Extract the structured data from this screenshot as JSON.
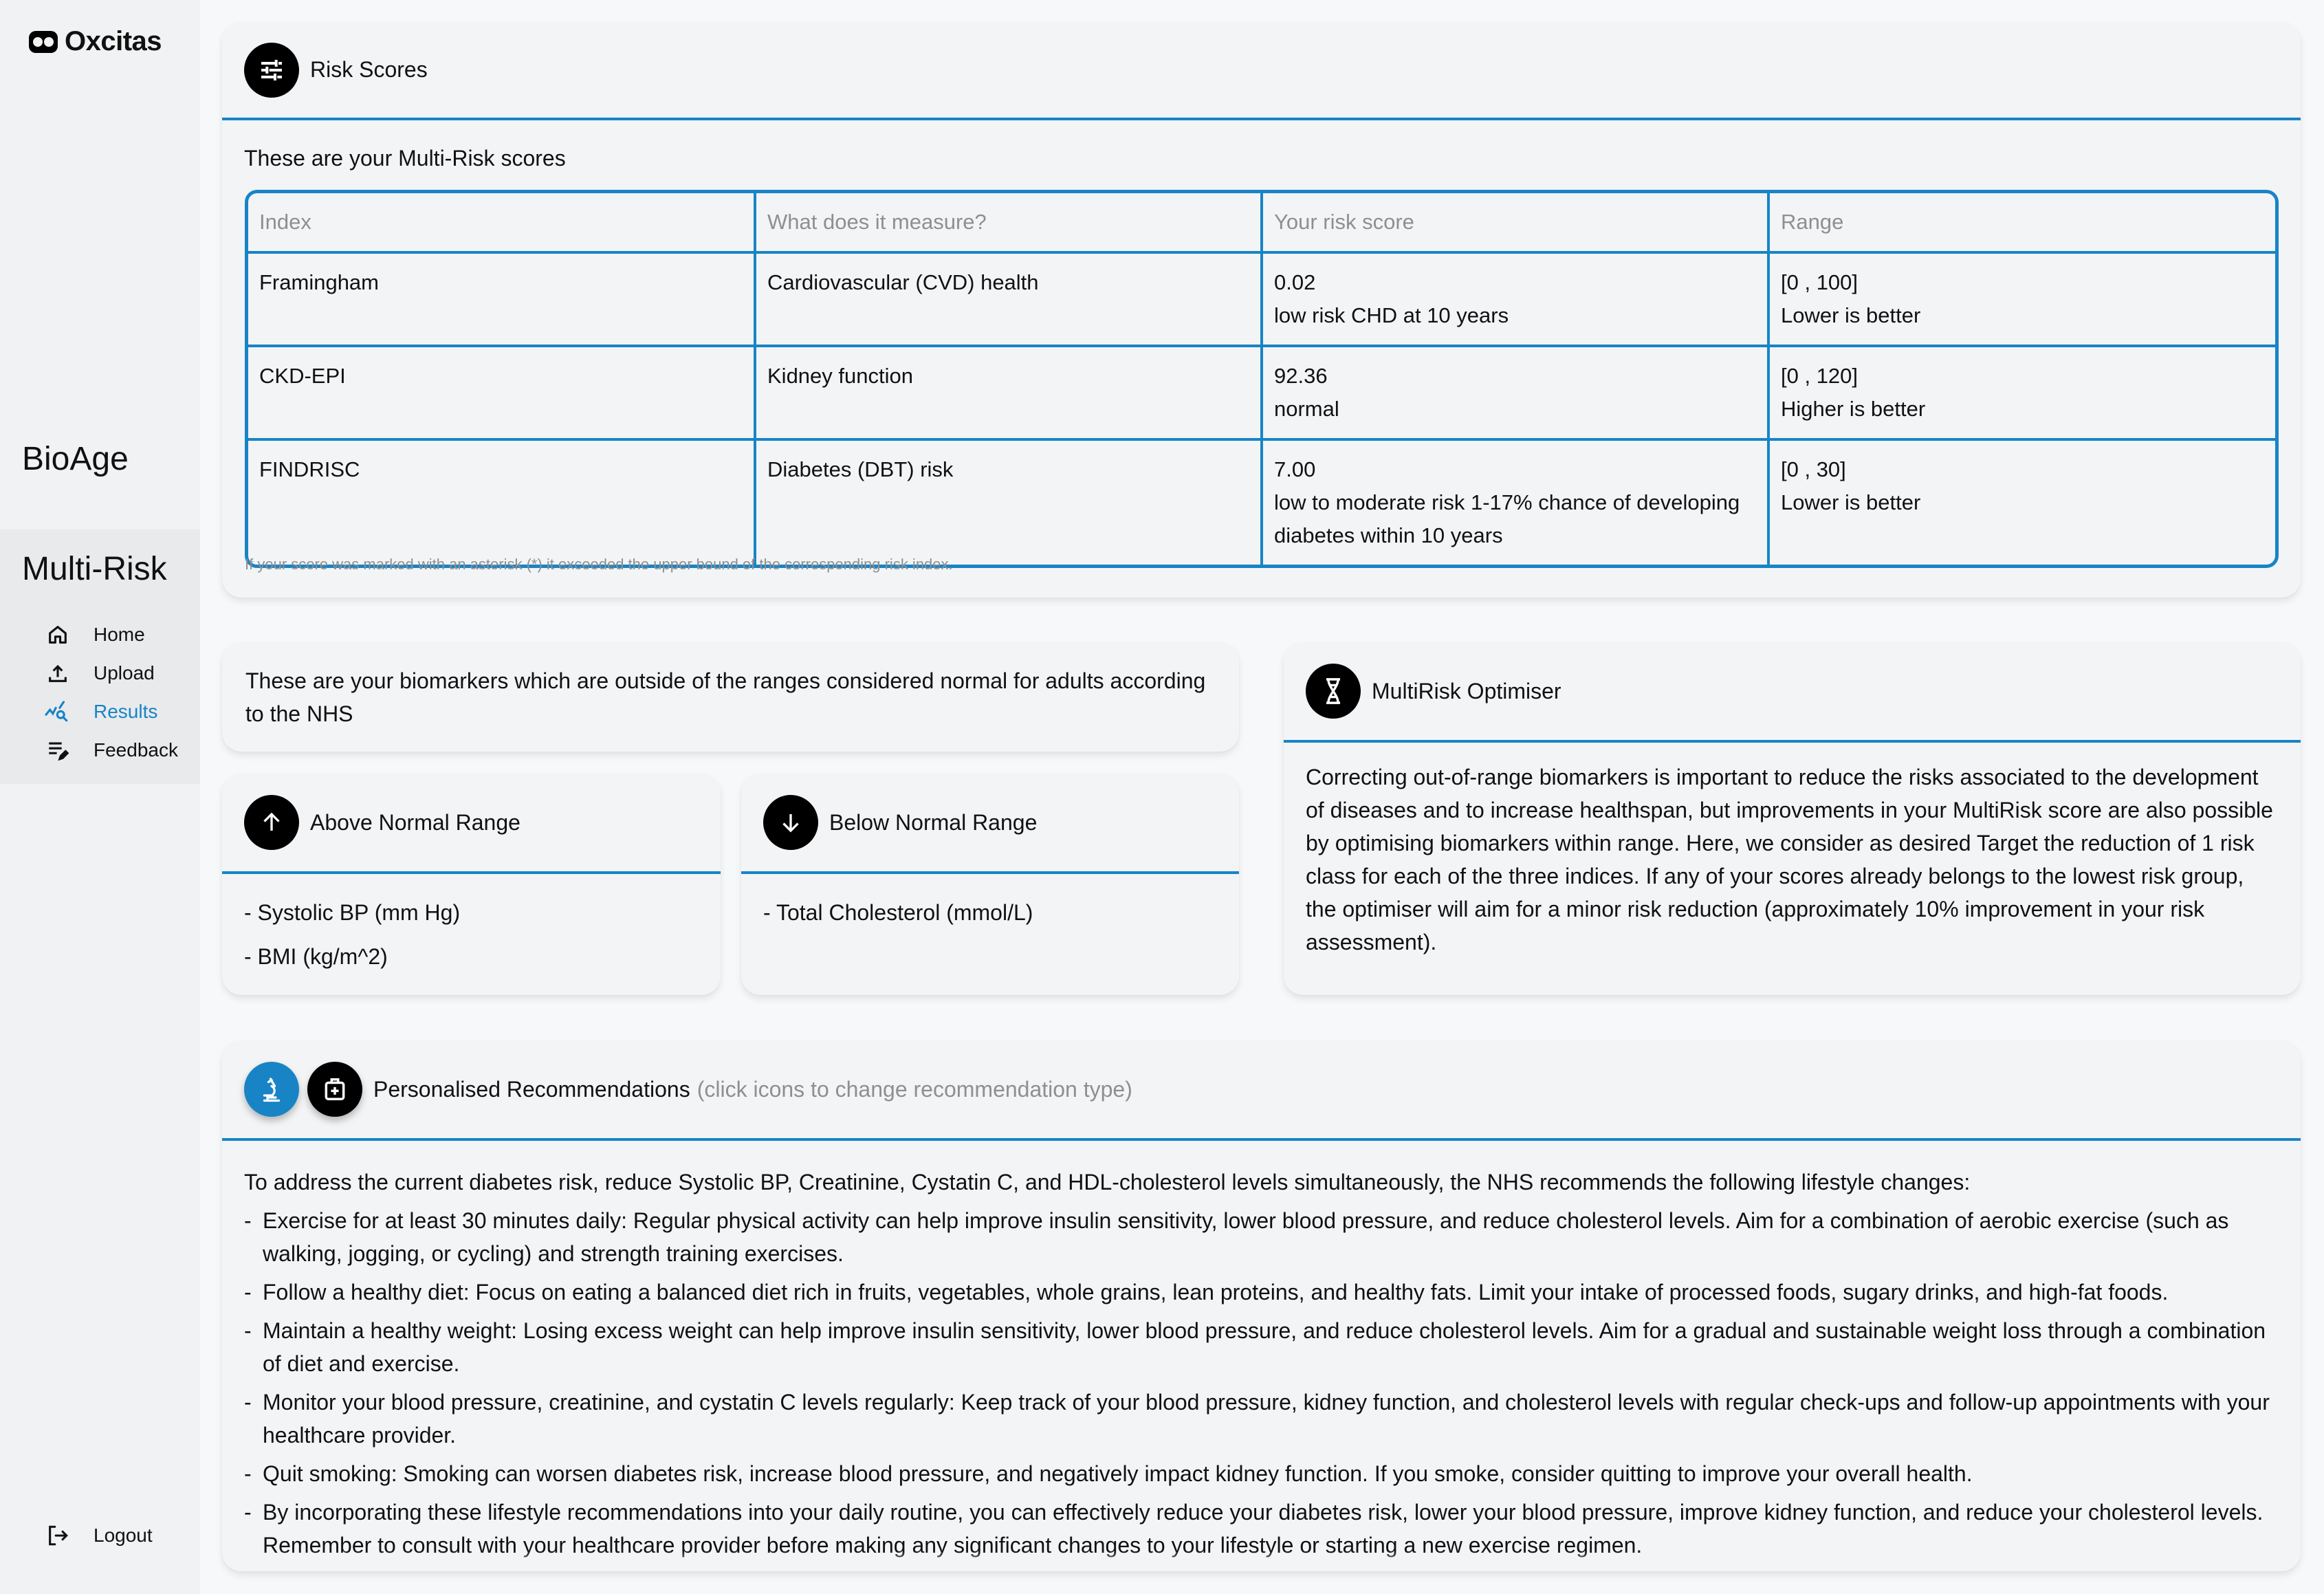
{
  "brand": {
    "name": "Oxcitas",
    "icon": "infinity-logo-icon"
  },
  "sidebar": {
    "sections": [
      {
        "title": "BioAge"
      },
      {
        "title": "Multi-Risk"
      }
    ],
    "items": [
      {
        "label": "Home",
        "icon": "home-icon",
        "active": false
      },
      {
        "label": "Upload",
        "icon": "upload-icon",
        "active": false
      },
      {
        "label": "Results",
        "icon": "results-analytics-icon",
        "active": true
      },
      {
        "label": "Feedback",
        "icon": "feedback-icon",
        "active": false
      }
    ],
    "logout_label": "Logout"
  },
  "colors": {
    "accent": "#1884c6",
    "muted": "#8f8f8f",
    "card_bg": "#f2f4f6"
  },
  "risk_scores": {
    "title": "Risk Scores",
    "intro": "These are your Multi-Risk scores",
    "columns": [
      "Index",
      "What does it measure?",
      "Your risk score",
      "Range"
    ],
    "rows": [
      {
        "index": "Framingham",
        "measure": "Cardiovascular (CVD) health",
        "score": "0.02",
        "score_note": "low risk CHD at 10 years",
        "range": "[0 , 100]",
        "range_note": "Lower is better"
      },
      {
        "index": "CKD-EPI",
        "measure": "Kidney function",
        "score": "92.36",
        "score_note": "normal",
        "range": "[0 , 120]",
        "range_note": "Higher is better"
      },
      {
        "index": "FINDRISC",
        "measure": "Diabetes (DBT) risk",
        "score": "7.00",
        "score_note": "low to moderate risk 1-17% chance of developing diabetes within 10 years",
        "range": "[0 , 30]",
        "range_note": "Lower is better"
      }
    ],
    "footnote": "If your score was marked with an asterisk (*) it exceeded the upper bound of the corresponding risk index."
  },
  "biomarkers": {
    "intro": "These are your biomarkers which are outside of the ranges considered normal for adults according to the NHS",
    "above": {
      "title": "Above Normal Range",
      "items": [
        "- Systolic BP (mm Hg)",
        "- BMI (kg/m^2)"
      ]
    },
    "below": {
      "title": "Below Normal Range",
      "items": [
        "- Total Cholesterol (mmol/L)"
      ]
    }
  },
  "optimiser": {
    "title": "MultiRisk Optimiser",
    "body": "Correcting out-of-range biomarkers is important to reduce the risks associated to the development of diseases and to increase healthspan, but improvements in your MultiRisk score are also possible by optimising biomarkers within range. Here, we consider as desired Target the reduction of 1 risk class for each of the three indices. If any of your scores already belongs to the lowest risk group, the optimiser will aim for a minor risk reduction (approximately 10% improvement in your risk assessment)."
  },
  "recommendations": {
    "title": "Personalised Recommendations",
    "hint": "(click icons to change recommendation type)",
    "intro": "To address the current diabetes risk, reduce Systolic BP, Creatinine, Cystatin C, and HDL-cholesterol levels simultaneously, the NHS recommends the following lifestyle changes:",
    "items": [
      "Exercise for at least 30 minutes daily: Regular physical activity can help improve insulin sensitivity, lower blood pressure, and reduce cholesterol levels. Aim for a combination of aerobic exercise (such as walking, jogging, or cycling) and strength training exercises.",
      "Follow a healthy diet: Focus on eating a balanced diet rich in fruits, vegetables, whole grains, lean proteins, and healthy fats. Limit your intake of processed foods, sugary drinks, and high-fat foods.",
      "Maintain a healthy weight: Losing excess weight can help improve insulin sensitivity, lower blood pressure, and reduce cholesterol levels. Aim for a gradual and sustainable weight loss through a combination of diet and exercise.",
      "Monitor your blood pressure, creatinine, and cystatin C levels regularly: Keep track of your blood pressure, kidney function, and cholesterol levels with regular check-ups and follow-up appointments with your healthcare provider.",
      "Quit smoking: Smoking can worsen diabetes risk, increase blood pressure, and negatively impact kidney function. If you smoke, consider quitting to improve your overall health.",
      "By incorporating these lifestyle recommendations into your daily routine, you can effectively reduce your diabetes risk, lower your blood pressure, improve kidney function, and reduce your cholesterol levels. Remember to consult with your healthcare provider before making any significant changes to your lifestyle or starting a new exercise regimen."
    ],
    "dash": "-"
  }
}
